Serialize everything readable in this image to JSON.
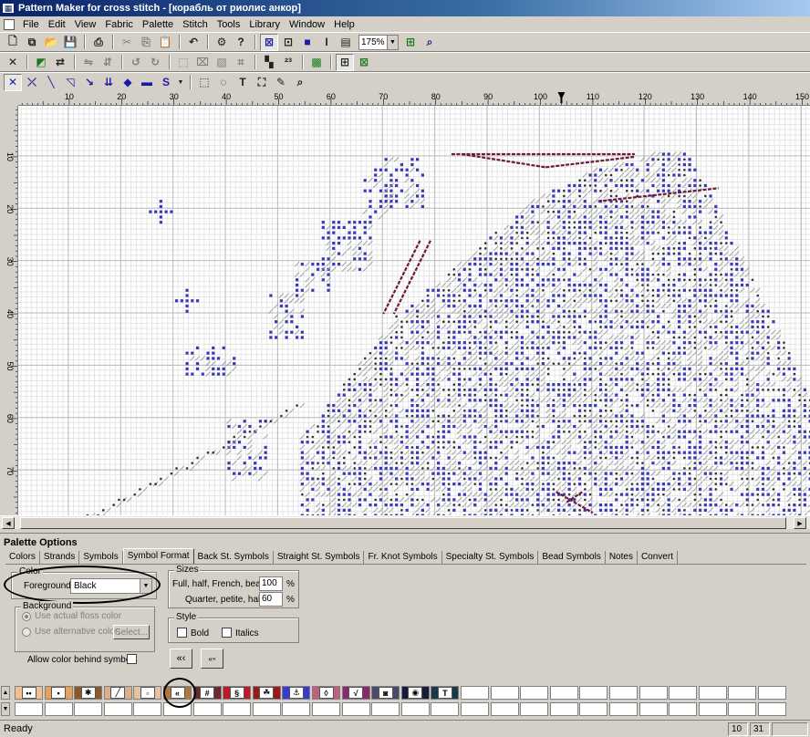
{
  "window": {
    "title": "Pattern Maker for cross stitch - [корабль от риолис анкор]"
  },
  "menu": [
    "File",
    "Edit",
    "View",
    "Fabric",
    "Palette",
    "Stitch",
    "Tools",
    "Library",
    "Window",
    "Help"
  ],
  "toolbar": {
    "zoom": "175%"
  },
  "ruler": {
    "h_ticks": [
      "10",
      "20",
      "30",
      "40",
      "50",
      "60",
      "70",
      "80",
      "90",
      "100",
      "110",
      "120",
      "130",
      "140",
      "150"
    ],
    "v_ticks": [
      "10",
      "20",
      "30",
      "40",
      "50",
      "60",
      "70"
    ]
  },
  "palette_options": {
    "title": "Palette Options",
    "tabs": [
      "Colors",
      "Strands",
      "Symbols",
      "Symbol Format",
      "Back St. Symbols",
      "Straight St. Symbols",
      "Fr. Knot Symbols",
      "Specialty St. Symbols",
      "Bead Symbols",
      "Notes",
      "Convert"
    ],
    "active_tab": "Symbol Format",
    "color": {
      "group_label": "Color",
      "foreground_label": "Foreground:",
      "foreground_value": "Black"
    },
    "background": {
      "group_label": "Background",
      "use_actual_label": "Use actual floss color",
      "use_alt_label": "Use alternative color:",
      "select_label": "Select..."
    },
    "allow_color_label": "Allow color behind symbols",
    "sizes": {
      "group_label": "Sizes",
      "full_label": "Full, half, French, bead:",
      "full_value": "100",
      "quarter_label": "Quarter, petite, half:",
      "quarter_value": "60",
      "unit": "%"
    },
    "style": {
      "group_label": "Style",
      "bold_label": "Bold",
      "italics_label": "Italics"
    }
  },
  "symbol_palette": [
    {
      "color": "#f1c28f",
      "sym": "••",
      "fg": "#000"
    },
    {
      "color": "#e8a060",
      "sym": "▪",
      "fg": "#1a1aa8"
    },
    {
      "color": "#8a5a2a",
      "sym": "✱",
      "fg": "#000"
    },
    {
      "color": "#d9b08c",
      "sym": "╱",
      "fg": "#000"
    },
    {
      "color": "#e6c3a0",
      "sym": "▫",
      "fg": "#000"
    },
    {
      "color": "#b07840",
      "sym": "«",
      "fg": "#000"
    },
    {
      "color": "#6a2a2a",
      "sym": "#",
      "fg": "#fff"
    },
    {
      "color": "#c01a2a",
      "sym": "§",
      "fg": "#fff"
    },
    {
      "color": "#9a1a1a",
      "sym": "☘",
      "fg": "#fff"
    },
    {
      "color": "#3a3ad0",
      "sym": "⚓",
      "fg": "#fff"
    },
    {
      "color": "#c06080",
      "sym": "◊",
      "fg": "#fff"
    },
    {
      "color": "#8a2a6a",
      "sym": "√",
      "fg": "#fff"
    },
    {
      "color": "#4a4a6a",
      "sym": "◙",
      "fg": "#fff"
    },
    {
      "color": "#1a1a3a",
      "sym": "◉",
      "fg": "#fff"
    },
    {
      "color": "#1a3a4a",
      "sym": "T",
      "fg": "#fff"
    }
  ],
  "status": {
    "text": "Ready",
    "cell1": "10",
    "cell2": "31"
  },
  "colors": {
    "title_start": "#0a246a",
    "title_end": "#a6caf0",
    "stitch_blue": "#3a3ab8",
    "stitch_dark": "#333333",
    "backstitch": "#6a1a3a"
  }
}
